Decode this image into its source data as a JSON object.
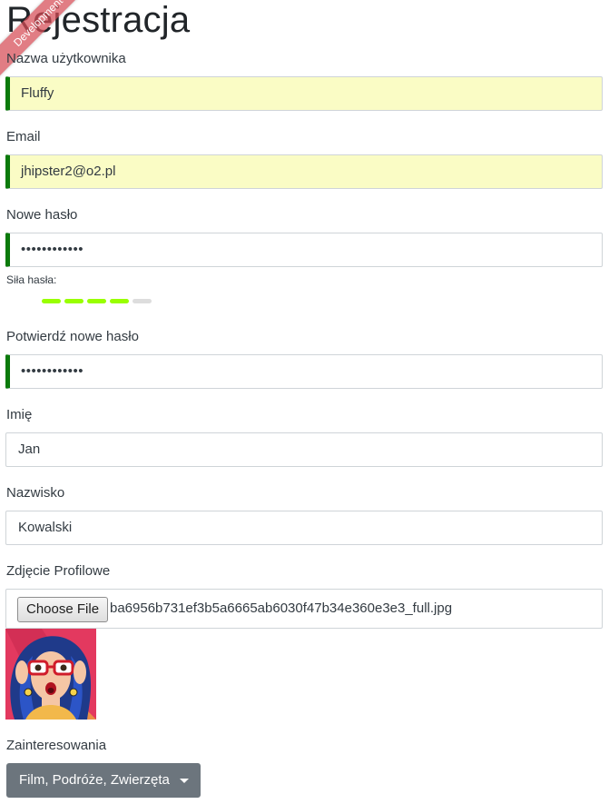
{
  "page": {
    "title": "Rejestracja",
    "ribbon": "Development"
  },
  "form": {
    "username": {
      "label": "Nazwa użytkownika",
      "value": "Fluffy"
    },
    "email": {
      "label": "Email",
      "value": "jhipster2@o2.pl"
    },
    "new_password": {
      "label": "Nowe hasło",
      "value": "••••••••••••"
    },
    "password_strength": {
      "label": "Siła hasła:",
      "active_segments": 4,
      "total_segments": 5,
      "active_color": "#99ff00",
      "inactive_color": "#dddddd"
    },
    "confirm_password": {
      "label": "Potwierdź nowe hasło",
      "value": "••••••••••••"
    },
    "first_name": {
      "label": "Imię",
      "value": "Jan"
    },
    "last_name": {
      "label": "Nazwisko",
      "value": "Kowalski"
    },
    "profile_photo": {
      "label": "Zdjęcie Profilowe",
      "button": "Choose File",
      "filename": "ba6956b731ef3b5a6665ab6030f47b34e360e3e3_full.jpg"
    },
    "interests": {
      "label": "Zainteresowania",
      "selected": "Film, Podróże, Zwierzęta"
    }
  },
  "colors": {
    "valid_border": "#0b7a0b",
    "autofill_bg": "#fafcc5",
    "dropdown_bg": "#6c757d",
    "ribbon_bg": "#d54b55"
  },
  "icons": {
    "dropdown": "caret-down-icon"
  }
}
